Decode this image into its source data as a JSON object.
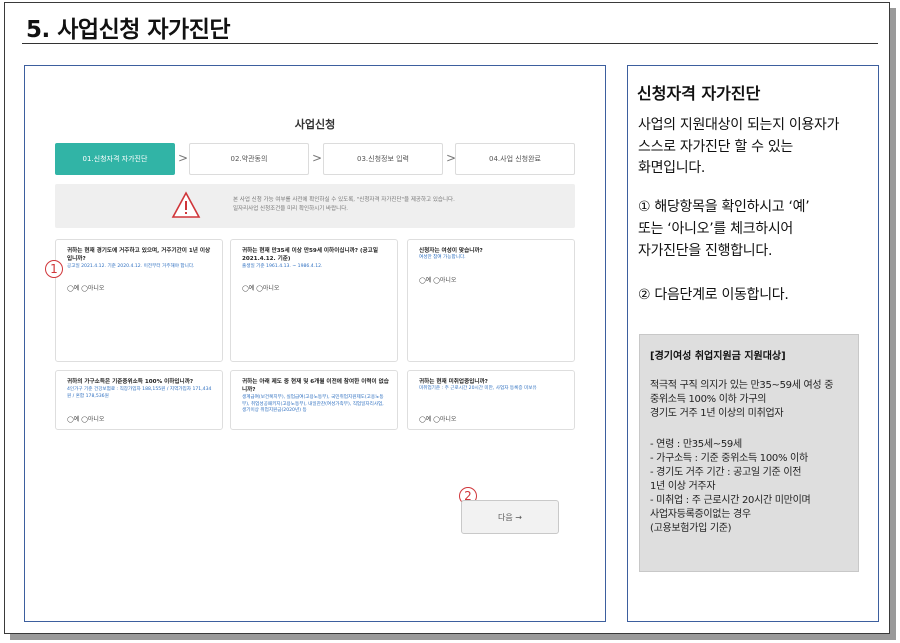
{
  "page": {
    "title": "5. 사업신청 자가진단"
  },
  "screen": {
    "title": "사업신청",
    "steps": [
      {
        "label": "01.신청자격 자가진단"
      },
      {
        "label": "02.약관동의"
      },
      {
        "label": "03.신청정보 입력"
      },
      {
        "label": "04.사업 신청완료"
      }
    ],
    "notice": {
      "line1": "본 사업 신청 가능 여부를 사전에 확인하실 수 있도록, \"신청자격 자가진단\"을 제공하고 있습니다.",
      "line2": "일자리사업 신청조건을 미리 확인하시기 바랍니다."
    },
    "questions": [
      {
        "q": "귀하는 현재 경기도에 거주하고 있으며, 거주기간이 1년 이상입니까?",
        "sub": "공고일 2021.4.12. 기준 2020.4.12. 이전부터 거주해야 합니다."
      },
      {
        "q": "귀하는 현재 만35세 이상 만59세 이하이십니까? (공고일 2021.4.12. 기준)",
        "sub": "출생일 기준 1961.4.13. ~ 1986.4.12."
      },
      {
        "q": "신청자는 여성이 맞습니까?",
        "sub": "여성만 참여 가능합니다."
      },
      {
        "q": "귀하의 가구소득은 기준중위소득 100% 이하입니까?",
        "sub": "4인가구 기준 건강보험료 : 직장가입자 188,155원 / 지역가입자 171,434원 / 혼합 178,536원"
      },
      {
        "q": "귀하는 아래 제도 중 현재 및 6개월 이전에 참여한 이력이 없습니까?",
        "sub": "생계급여(보건복지부), 실업급여(고용노동부), 국민취업지원제도(고용노동부), 취업성공패키지(고용노동부), 내일찬찬(여성가족부), 직업일자리사업, 생기이상 취업지원금(2020년) 등"
      },
      {
        "q": "귀하는 현재 미취업중입니까?",
        "sub": "미취업기준 : 주 근로시간 20시간 미만, 사업자 등록증 미보유"
      }
    ],
    "radios": "◯예 ◯아니오",
    "next_button": "다음 →",
    "badge1": "1",
    "badge2": "2"
  },
  "side": {
    "title": "신청자격 자가진단",
    "desc": [
      "사업의 지원대상이 되는지 이용자가",
      "스스로 자가진단 할 수 있는",
      "화면입니다."
    ],
    "step1": [
      "① 해당항목을 확인하시고 ‘예’",
      " 또는 ‘아니오’를 체크하시어",
      " 자가진단을  진행합니다."
    ],
    "step2": "② 다음단계로 이동합니다.",
    "box": {
      "title": "[경기여성 취업지원금 지원대상]",
      "intro": [
        "적극적 구직 의지가 있는 만35~59세 여성 중",
        "중위소득 100% 이하 가구의",
        "경기도 거주 1년 이상의 미취업자"
      ],
      "items": [
        "- 연령 : 만35세~59세",
        "- 가구소득 : 기준 중위소득 100% 이하",
        "- 경기도 거주 기간 : 공고일 기준 이전",
        "   1년 이상 거주자",
        "- 미취업 : 주 근로시간 20시간 미만이며",
        "  사업자등록증이없는 경우",
        "  (고용보험가입 기준)"
      ]
    }
  },
  "colors": {
    "accent": "#31b4a6",
    "border": "#3d5f9e",
    "badge": "#d0363a"
  }
}
